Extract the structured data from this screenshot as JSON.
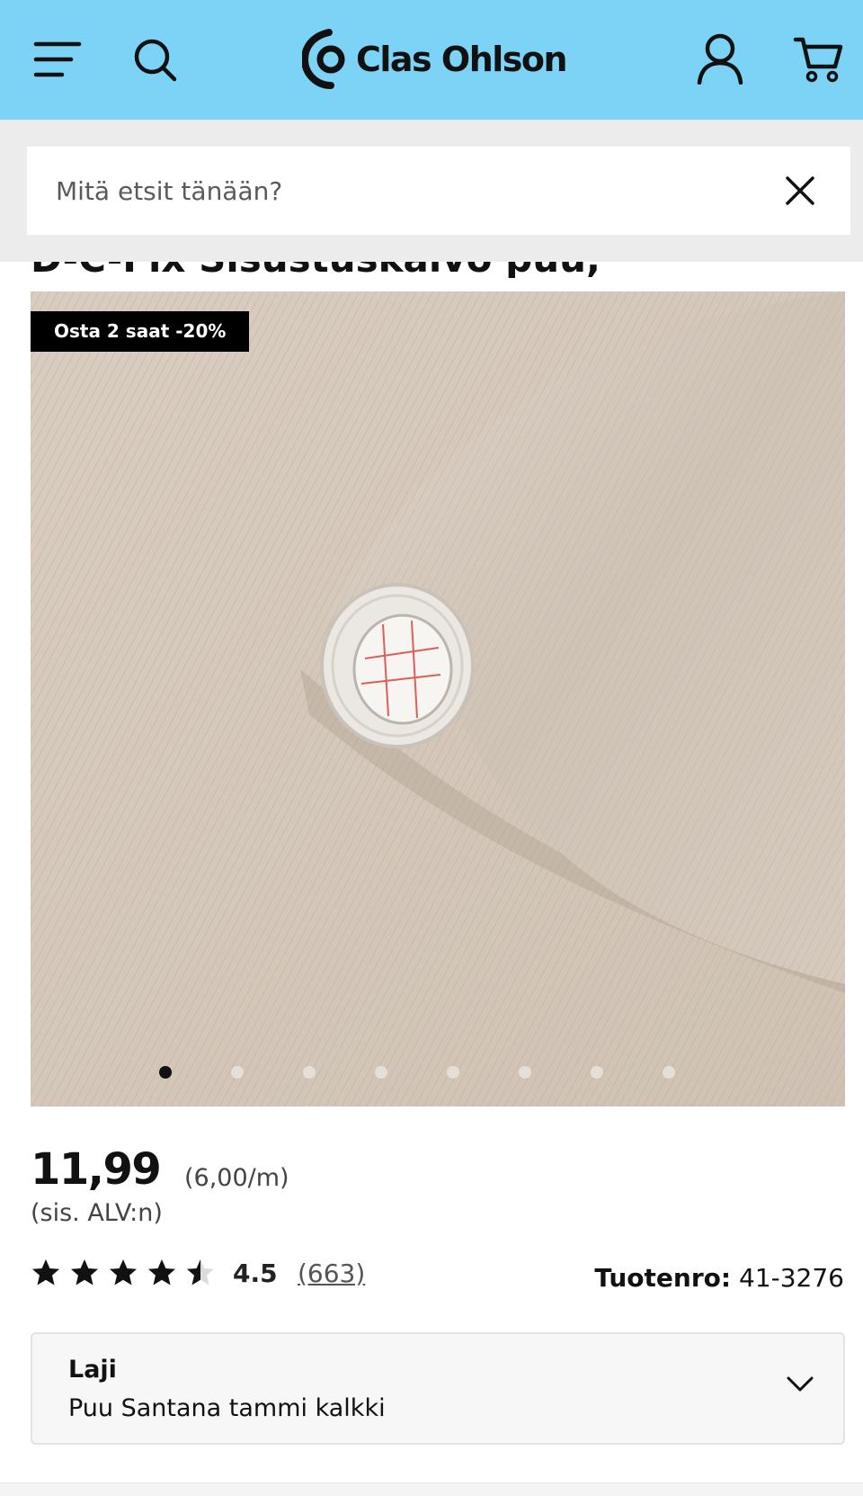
{
  "header": {
    "background_color": "#7dd3f6",
    "brand": "Clas Ohlson",
    "icons": [
      "menu-icon",
      "search-icon",
      "account-icon",
      "cart-icon"
    ]
  },
  "search": {
    "placeholder": "Mitä etsit tänään?",
    "value": ""
  },
  "product": {
    "title": "D-C-Fix Sisustuskalvo puu,",
    "promo_badge": "Osta 2 saat -20%",
    "image_alt": "Puu Santana tammi kalkki",
    "gallery_dot_count": 8,
    "gallery_active_index": 0,
    "price": "11,99",
    "unit_price": "(6,00/m)",
    "vat_note": "(sis. ALV:n)",
    "rating": {
      "value": 4.5,
      "display": "4.5",
      "max": 5,
      "count": "(663)"
    },
    "product_number_label": "Tuotenro:",
    "product_number": "41-3276",
    "variant": {
      "label": "Laji",
      "value": "Puu Santana tammi kalkki"
    }
  }
}
